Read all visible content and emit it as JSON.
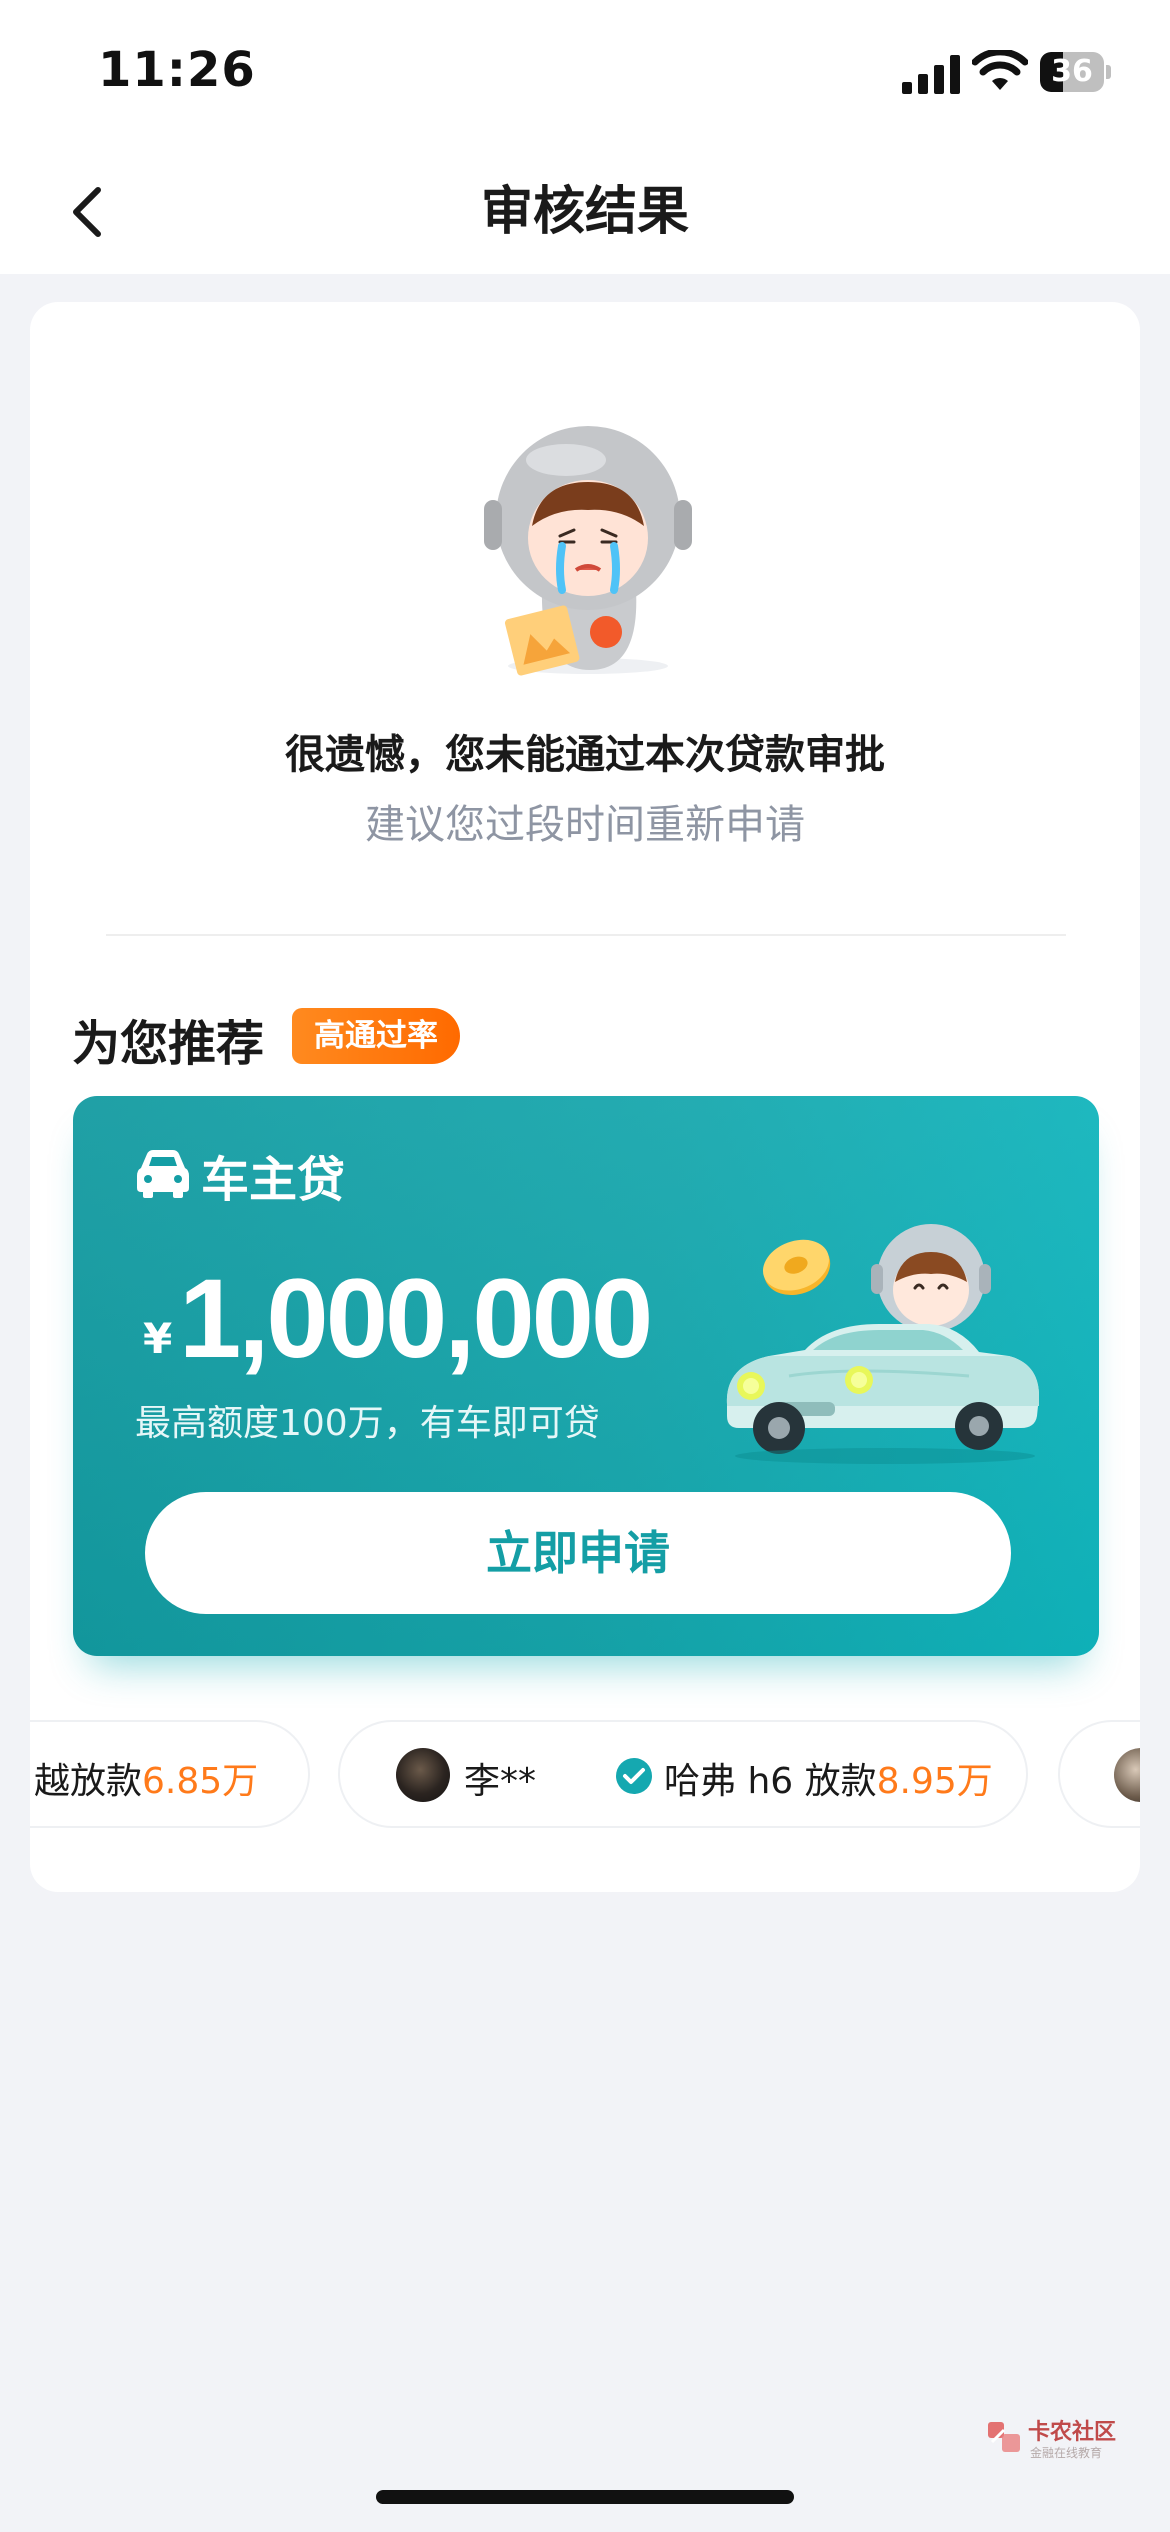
{
  "status_bar": {
    "time": "11:26",
    "battery": 36,
    "battery_label": "36"
  },
  "nav": {
    "title": "审核结果"
  },
  "result": {
    "title": "很遗憾，您未能通过本次贷款审批",
    "subtitle": "建议您过段时间重新申请"
  },
  "recommend": {
    "title": "为您推荐",
    "badge": "高通过率"
  },
  "product": {
    "name": "车主贷",
    "currency": "¥",
    "amount": "1,000,000",
    "description": "最高额度100万，有车即可贷",
    "apply_label": "立即申请"
  },
  "ticker": {
    "items": [
      {
        "text": "越放款",
        "amount": "6.85万"
      },
      {
        "user": "李**",
        "text": "哈弗 h6 放款",
        "amount": "8.95万"
      }
    ]
  },
  "watermark": {
    "name": "卡农社区",
    "tagline": "金融在线教育"
  },
  "colors": {
    "accent": "#149ea5",
    "badge": "#ff7a1a",
    "amount_highlight": "#ff7a1a"
  },
  "icons": [
    "back-chevron-icon",
    "signal-icon",
    "wifi-icon",
    "battery-icon",
    "car-icon",
    "check-circle-icon"
  ]
}
